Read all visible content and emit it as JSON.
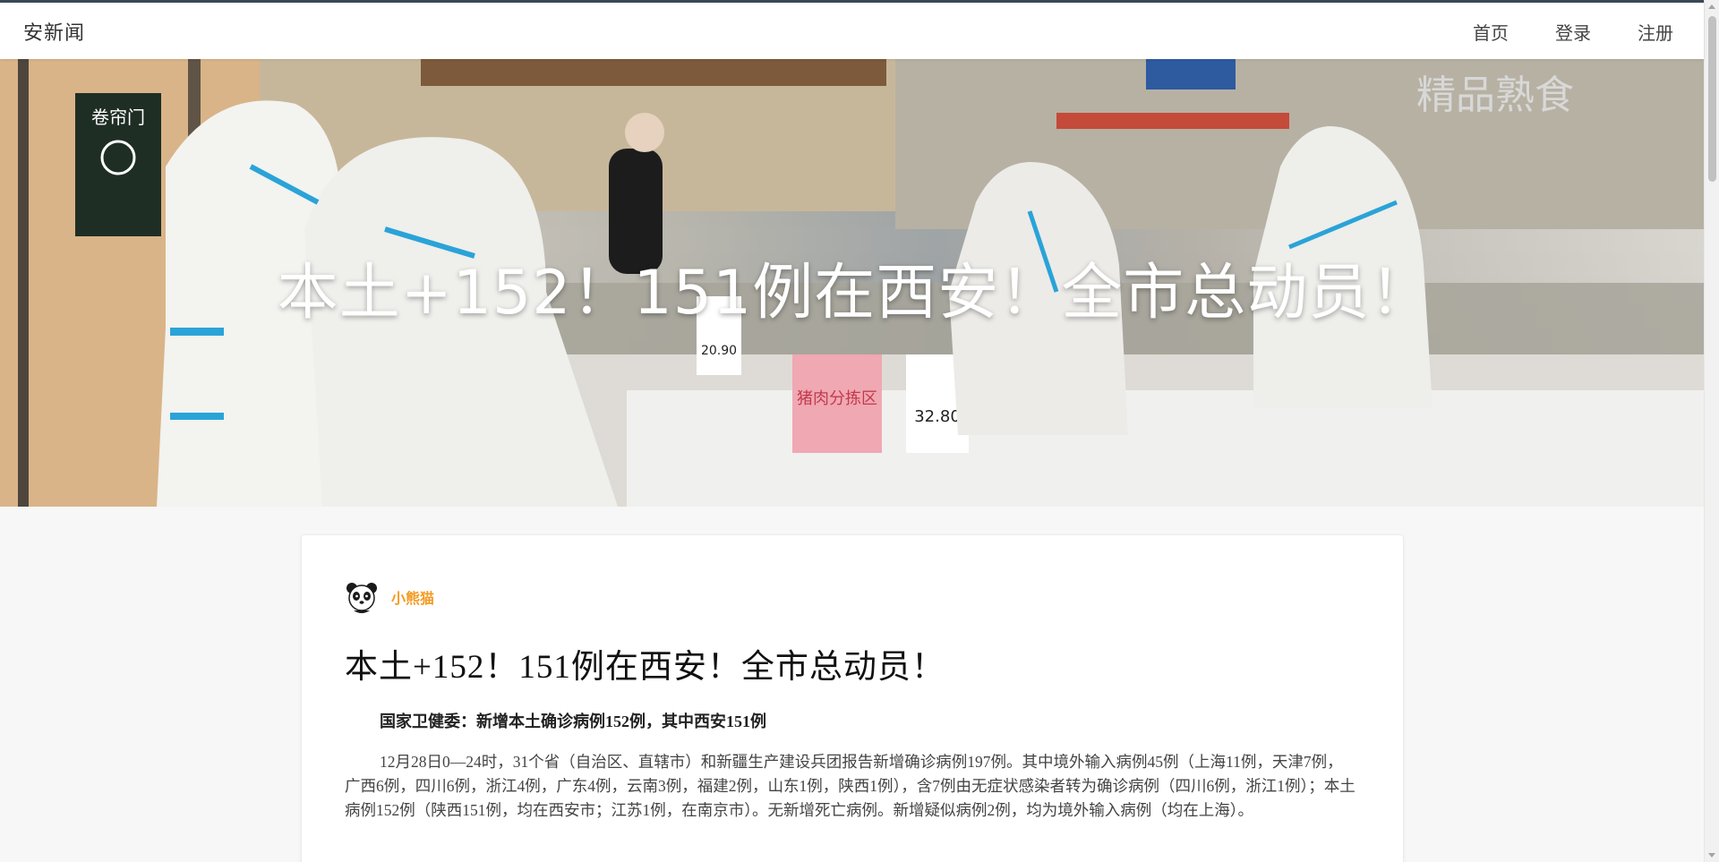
{
  "header": {
    "brand": "安新闻",
    "nav": [
      {
        "label": "首页"
      },
      {
        "label": "登录"
      },
      {
        "label": "注册"
      }
    ]
  },
  "hero": {
    "title": "本土+152！151例在西安！全市总动员！",
    "image_icon": "photo-image",
    "sign_text": "卷帘门",
    "price_1": "20.90",
    "price_2": "32.80",
    "sign_2": "猪肉分拣区",
    "store_sign": "精品熟食"
  },
  "article": {
    "author": {
      "name": "小熊猫",
      "avatar_icon": "panda-avatar-icon"
    },
    "title": "本土+152！151例在西安！全市总动员！",
    "subhead": "国家卫健委：新增本土确诊病例152例，其中西安151例",
    "paragraph": "12月28日0—24时，31个省（自治区、直辖市）和新疆生产建设兵团报告新增确诊病例197例。其中境外输入病例45例（上海11例，天津7例，广西6例，四川6例，浙江4例，广东4例，云南3例，福建2例，山东1例，陕西1例），含7例由无症状感染者转为确诊病例（四川6例，浙江1例）；本土病例152例（陕西151例，均在西安市；江苏1例，在南京市）。无新增死亡病例。新增疑似病例2例，均为境外输入病例（均在上海）。"
  },
  "colors": {
    "author_accent": "#f39b22",
    "topbar_border": "#3a4654"
  }
}
